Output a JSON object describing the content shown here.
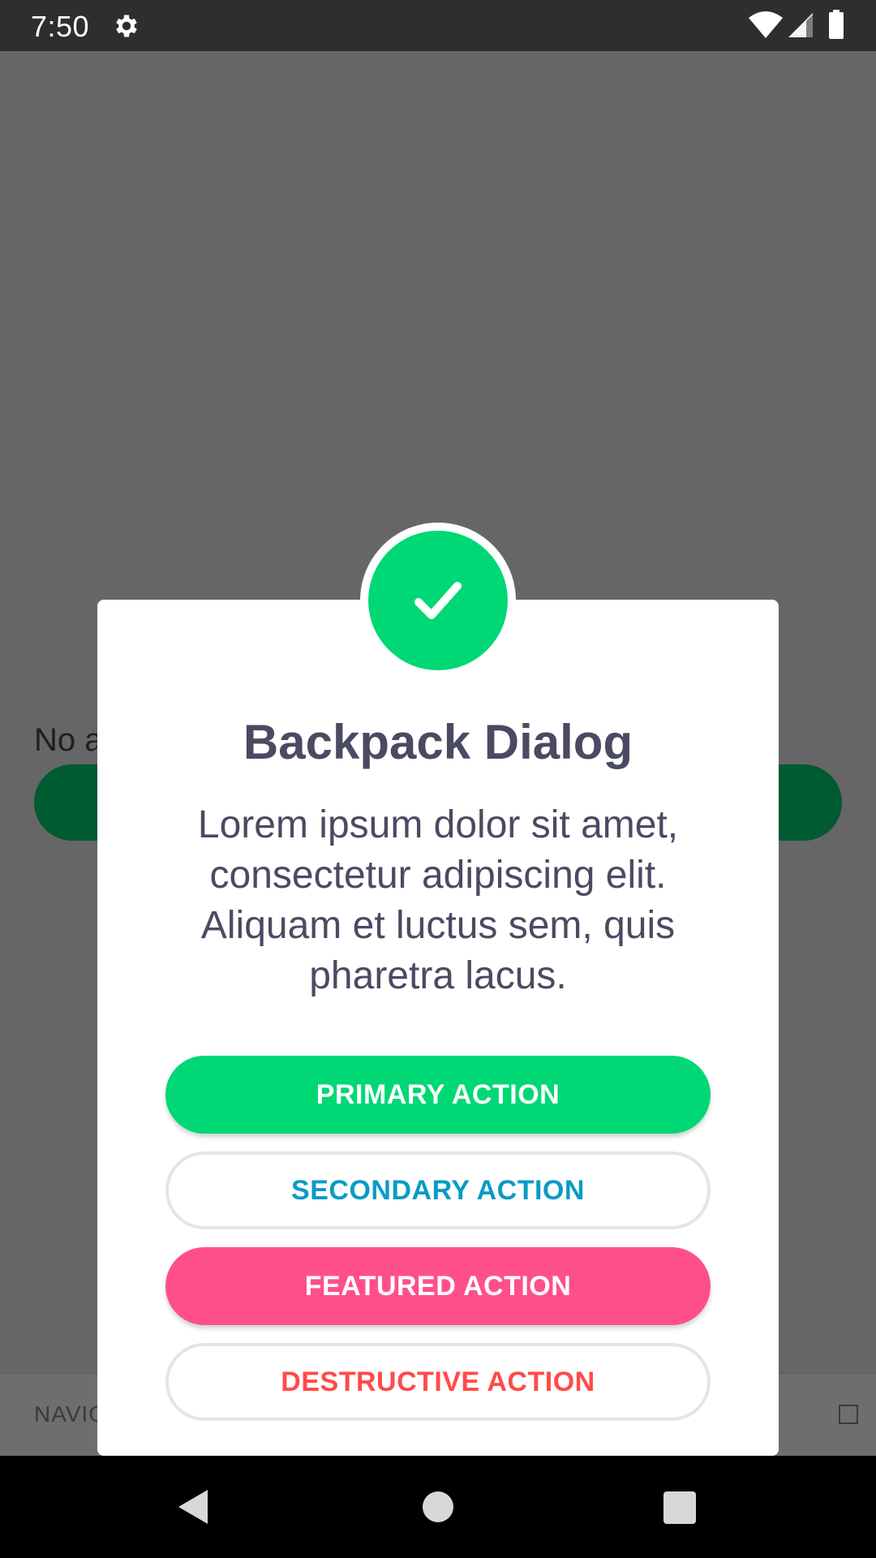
{
  "status_bar": {
    "time": "7:50",
    "icons": [
      "gear-icon",
      "wifi-icon",
      "cell-signal-icon",
      "battery-icon"
    ]
  },
  "background": {
    "text": "No a",
    "bottom_nav_label": "NAVIG"
  },
  "dialog": {
    "icon": "check-icon",
    "icon_color": "#00d775",
    "title": "Backpack Dialog",
    "body": "Lorem ipsum dolor sit amet, consectetur adipiscing elit. Aliquam et luctus sem, quis pharetra lacus.",
    "buttons": {
      "primary": "PRIMARY ACTION",
      "secondary": "SECONDARY ACTION",
      "featured": "FEATURED ACTION",
      "destructive": "DESTRUCTIVE ACTION"
    }
  },
  "colors": {
    "primary": "#00d775",
    "secondary_text": "#0a9bc4",
    "featured": "#ff4f8b",
    "destructive_text": "#ff4a4a",
    "title_text": "#4a4a63"
  },
  "nav_bar": {
    "icons": [
      "back-icon",
      "home-icon",
      "recents-icon"
    ]
  }
}
